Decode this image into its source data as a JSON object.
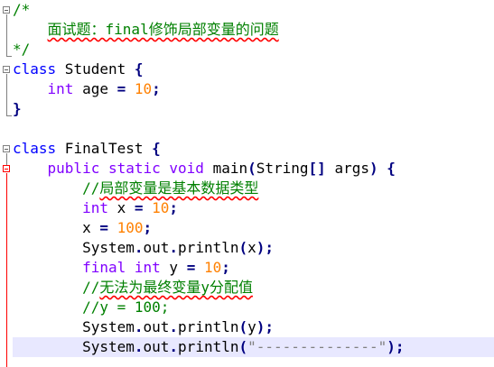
{
  "editor": {
    "lines": [
      [
        {
          "t": "/*",
          "c": "c"
        }
      ],
      [
        {
          "t": "    ",
          "c": "d"
        },
        {
          "t": "面试题：final修饰局部变量的问题",
          "c": "c sq"
        }
      ],
      [
        {
          "t": "*/",
          "c": "c"
        }
      ],
      [
        {
          "t": "class",
          "c": "k"
        },
        {
          "t": " Student ",
          "c": "d"
        },
        {
          "t": "{",
          "c": "p"
        }
      ],
      [
        {
          "t": "    ",
          "c": "d"
        },
        {
          "t": "int",
          "c": "t"
        },
        {
          "t": " age ",
          "c": "d"
        },
        {
          "t": "=",
          "c": "p"
        },
        {
          "t": " ",
          "c": "d"
        },
        {
          "t": "10",
          "c": "n"
        },
        {
          "t": ";",
          "c": "p"
        }
      ],
      [
        {
          "t": "}",
          "c": "p"
        }
      ],
      [
        {
          "t": "",
          "c": "d"
        }
      ],
      [
        {
          "t": "class",
          "c": "k"
        },
        {
          "t": " FinalTest ",
          "c": "d"
        },
        {
          "t": "{",
          "c": "p"
        }
      ],
      [
        {
          "t": "    ",
          "c": "d"
        },
        {
          "t": "public",
          "c": "t"
        },
        {
          "t": " ",
          "c": "d"
        },
        {
          "t": "static",
          "c": "t"
        },
        {
          "t": " ",
          "c": "d"
        },
        {
          "t": "void",
          "c": "t"
        },
        {
          "t": " main",
          "c": "d"
        },
        {
          "t": "(",
          "c": "p"
        },
        {
          "t": "String",
          "c": "d"
        },
        {
          "t": "[]",
          "c": "p"
        },
        {
          "t": " args",
          "c": "d"
        },
        {
          "t": ")",
          "c": "p"
        },
        {
          "t": " ",
          "c": "d"
        },
        {
          "t": "{",
          "c": "p"
        }
      ],
      [
        {
          "t": "        ",
          "c": "d"
        },
        {
          "t": "//",
          "c": "c"
        },
        {
          "t": "局部变量是基本数据类型",
          "c": "c sq"
        }
      ],
      [
        {
          "t": "        ",
          "c": "d"
        },
        {
          "t": "int",
          "c": "t"
        },
        {
          "t": " x ",
          "c": "d"
        },
        {
          "t": "=",
          "c": "p"
        },
        {
          "t": " ",
          "c": "d"
        },
        {
          "t": "10",
          "c": "n"
        },
        {
          "t": ";",
          "c": "p"
        }
      ],
      [
        {
          "t": "        ",
          "c": "d"
        },
        {
          "t": "x ",
          "c": "d"
        },
        {
          "t": "=",
          "c": "p"
        },
        {
          "t": " ",
          "c": "d"
        },
        {
          "t": "100",
          "c": "n"
        },
        {
          "t": ";",
          "c": "p"
        }
      ],
      [
        {
          "t": "        ",
          "c": "d"
        },
        {
          "t": "System",
          "c": "d"
        },
        {
          "t": ".",
          "c": "p"
        },
        {
          "t": "out",
          "c": "d"
        },
        {
          "t": ".",
          "c": "p"
        },
        {
          "t": "println",
          "c": "d"
        },
        {
          "t": "(",
          "c": "p"
        },
        {
          "t": "x",
          "c": "d"
        },
        {
          "t": ");",
          "c": "p"
        }
      ],
      [
        {
          "t": "        ",
          "c": "d"
        },
        {
          "t": "final",
          "c": "t"
        },
        {
          "t": " ",
          "c": "d"
        },
        {
          "t": "int",
          "c": "t"
        },
        {
          "t": " y ",
          "c": "d"
        },
        {
          "t": "=",
          "c": "p"
        },
        {
          "t": " ",
          "c": "d"
        },
        {
          "t": "10",
          "c": "n"
        },
        {
          "t": ";",
          "c": "p"
        }
      ],
      [
        {
          "t": "        ",
          "c": "d"
        },
        {
          "t": "//",
          "c": "c"
        },
        {
          "t": "无法为最终变量y分配值",
          "c": "c sq"
        }
      ],
      [
        {
          "t": "        ",
          "c": "d"
        },
        {
          "t": "//y = 100;",
          "c": "c"
        }
      ],
      [
        {
          "t": "        ",
          "c": "d"
        },
        {
          "t": "System",
          "c": "d"
        },
        {
          "t": ".",
          "c": "p"
        },
        {
          "t": "out",
          "c": "d"
        },
        {
          "t": ".",
          "c": "p"
        },
        {
          "t": "println",
          "c": "d"
        },
        {
          "t": "(",
          "c": "p"
        },
        {
          "t": "y",
          "c": "d"
        },
        {
          "t": ");",
          "c": "p"
        }
      ],
      [
        {
          "t": "        ",
          "c": "d"
        },
        {
          "t": "System",
          "c": "d"
        },
        {
          "t": ".",
          "c": "p"
        },
        {
          "t": "out",
          "c": "d"
        },
        {
          "t": ".",
          "c": "p"
        },
        {
          "t": "println",
          "c": "d"
        },
        {
          "t": "(",
          "c": "p"
        },
        {
          "t": "\"--------------\"",
          "c": "s"
        },
        {
          "t": ");",
          "c": "p"
        }
      ]
    ]
  }
}
